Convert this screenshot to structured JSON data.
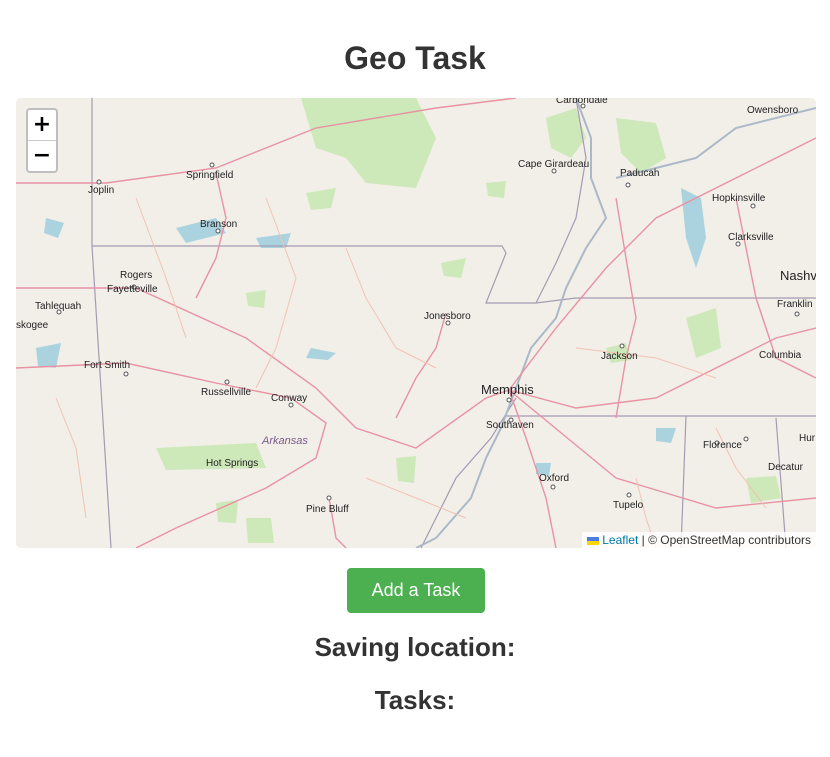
{
  "page": {
    "title": "Geo Task"
  },
  "map": {
    "zoom_in_label": "+",
    "zoom_out_label": "−",
    "attribution": {
      "leaflet_label": "Leaflet",
      "separator": " | © ",
      "osm_label": "OpenStreetMap contributors"
    },
    "cities": [
      "Carbondale",
      "Owensboro",
      "Joplin",
      "Springfield",
      "Cape Girardeau",
      "Paducah",
      "Hopkinsville",
      "Branson",
      "Clarksville",
      "Rogers",
      "Fayetteville",
      "Nashv",
      "Tahlequah",
      "Franklin",
      "skogee",
      "Jonesboro",
      "Jackson",
      "Columbia",
      "Fort Smith",
      "Memphis",
      "Russellville",
      "Conway",
      "Southaven",
      "Arkansas",
      "Florence",
      "Hur",
      "Hot Springs",
      "Decatur",
      "Oxford",
      "Pine Bluff",
      "Tupelo"
    ]
  },
  "actions": {
    "add_task_label": "Add a Task"
  },
  "sections": {
    "saving_location_label": "Saving location:",
    "tasks_label": "Tasks:"
  }
}
